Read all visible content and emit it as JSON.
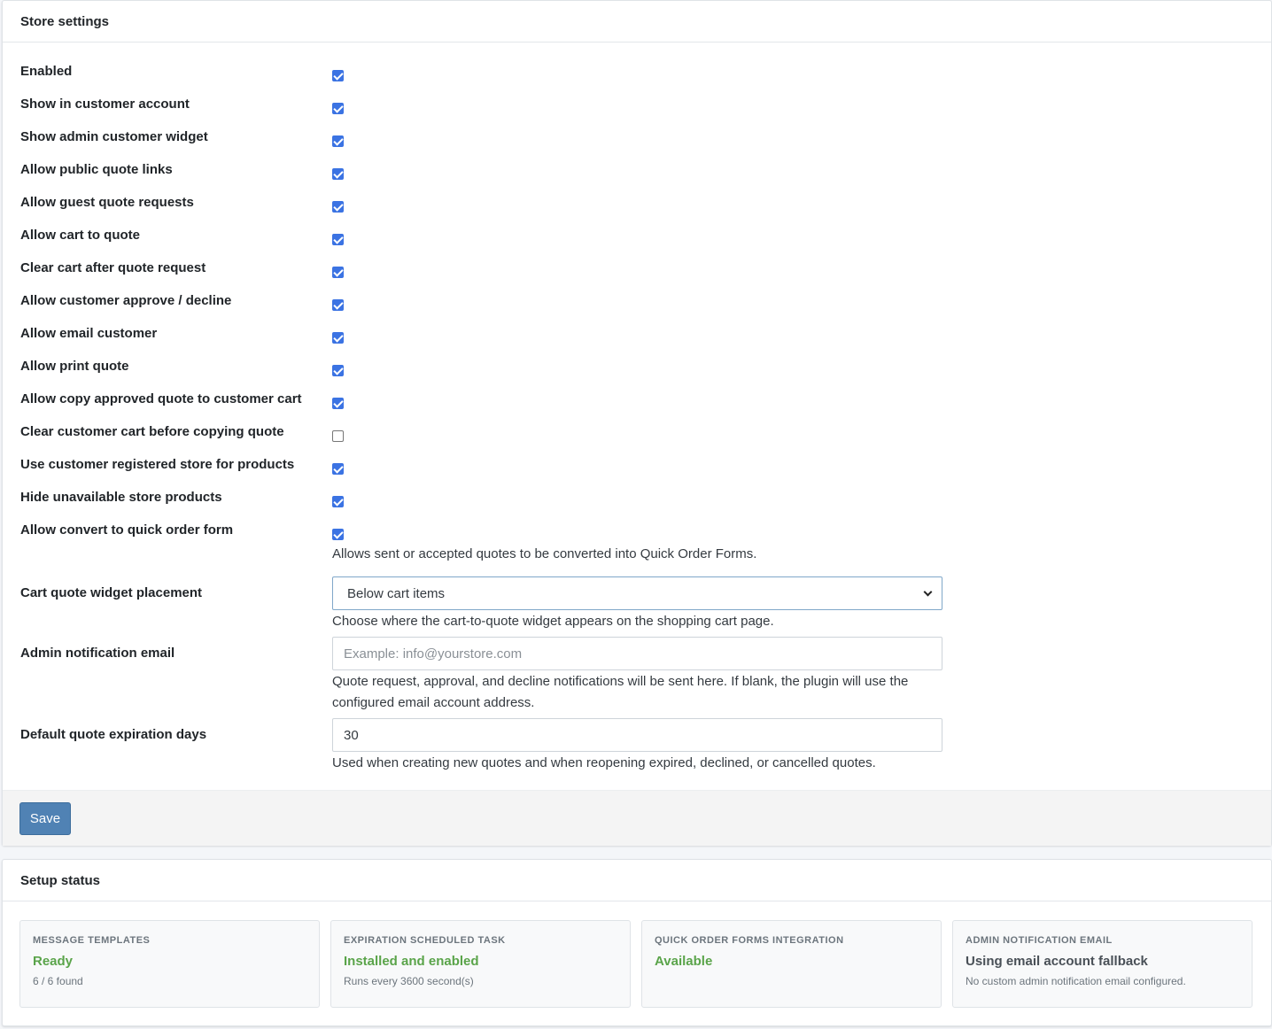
{
  "store_settings": {
    "title": "Store settings",
    "checkbox_rows": [
      {
        "label": "Enabled",
        "checked": true
      },
      {
        "label": "Show in customer account",
        "checked": true
      },
      {
        "label": "Show admin customer widget",
        "checked": true
      },
      {
        "label": "Allow public quote links",
        "checked": true
      },
      {
        "label": "Allow guest quote requests",
        "checked": true
      },
      {
        "label": "Allow cart to quote",
        "checked": true
      },
      {
        "label": "Clear cart after quote request",
        "checked": true
      },
      {
        "label": "Allow customer approve / decline",
        "checked": true
      },
      {
        "label": "Allow email customer",
        "checked": true
      },
      {
        "label": "Allow print quote",
        "checked": true
      },
      {
        "label": "Allow copy approved quote to customer cart",
        "checked": true
      },
      {
        "label": "Clear customer cart before copying quote",
        "checked": false
      },
      {
        "label": "Use customer registered store for products",
        "checked": true
      },
      {
        "label": "Hide unavailable store products",
        "checked": true
      },
      {
        "label": "Allow convert to quick order form",
        "checked": true
      }
    ],
    "quick_order_help": "Allows sent or accepted quotes to be converted into Quick Order Forms.",
    "widget_placement": {
      "label": "Cart quote widget placement",
      "selected": "Below cart items",
      "help": "Choose where the cart-to-quote widget appears on the shopping cart page."
    },
    "admin_email": {
      "label": "Admin notification email",
      "value": "",
      "placeholder": "Example: info@yourstore.com",
      "help_line1": "Quote request, approval, and decline notifications will be sent here. If blank, the plugin will use the",
      "help_line2": "configured email account address."
    },
    "expiration_days": {
      "label": "Default quote expiration days",
      "value": "30",
      "help": "Used when creating new quotes and when reopening expired, declined, or cancelled quotes."
    },
    "save_label": "Save"
  },
  "setup_status": {
    "title": "Setup status",
    "cards": [
      {
        "title": "MESSAGE TEMPLATES",
        "value": "Ready",
        "value_color": "#5aa44a",
        "sub": "6 / 6 found"
      },
      {
        "title": "EXPIRATION SCHEDULED TASK",
        "value": "Installed and enabled",
        "value_color": "#5aa44a",
        "sub": "Runs every 3600 second(s)"
      },
      {
        "title": "QUICK ORDER FORMS INTEGRATION",
        "value": "Available",
        "value_color": "#5aa44a",
        "sub": ""
      },
      {
        "title": "ADMIN NOTIFICATION EMAIL",
        "value": "Using email account fallback",
        "value_color": "#495057",
        "sub": "No custom admin notification email configured."
      }
    ]
  },
  "colors": {
    "checkbox_accent": "#3b73e3",
    "save_button": "#5082b4",
    "status_green": "#5aa44a"
  }
}
